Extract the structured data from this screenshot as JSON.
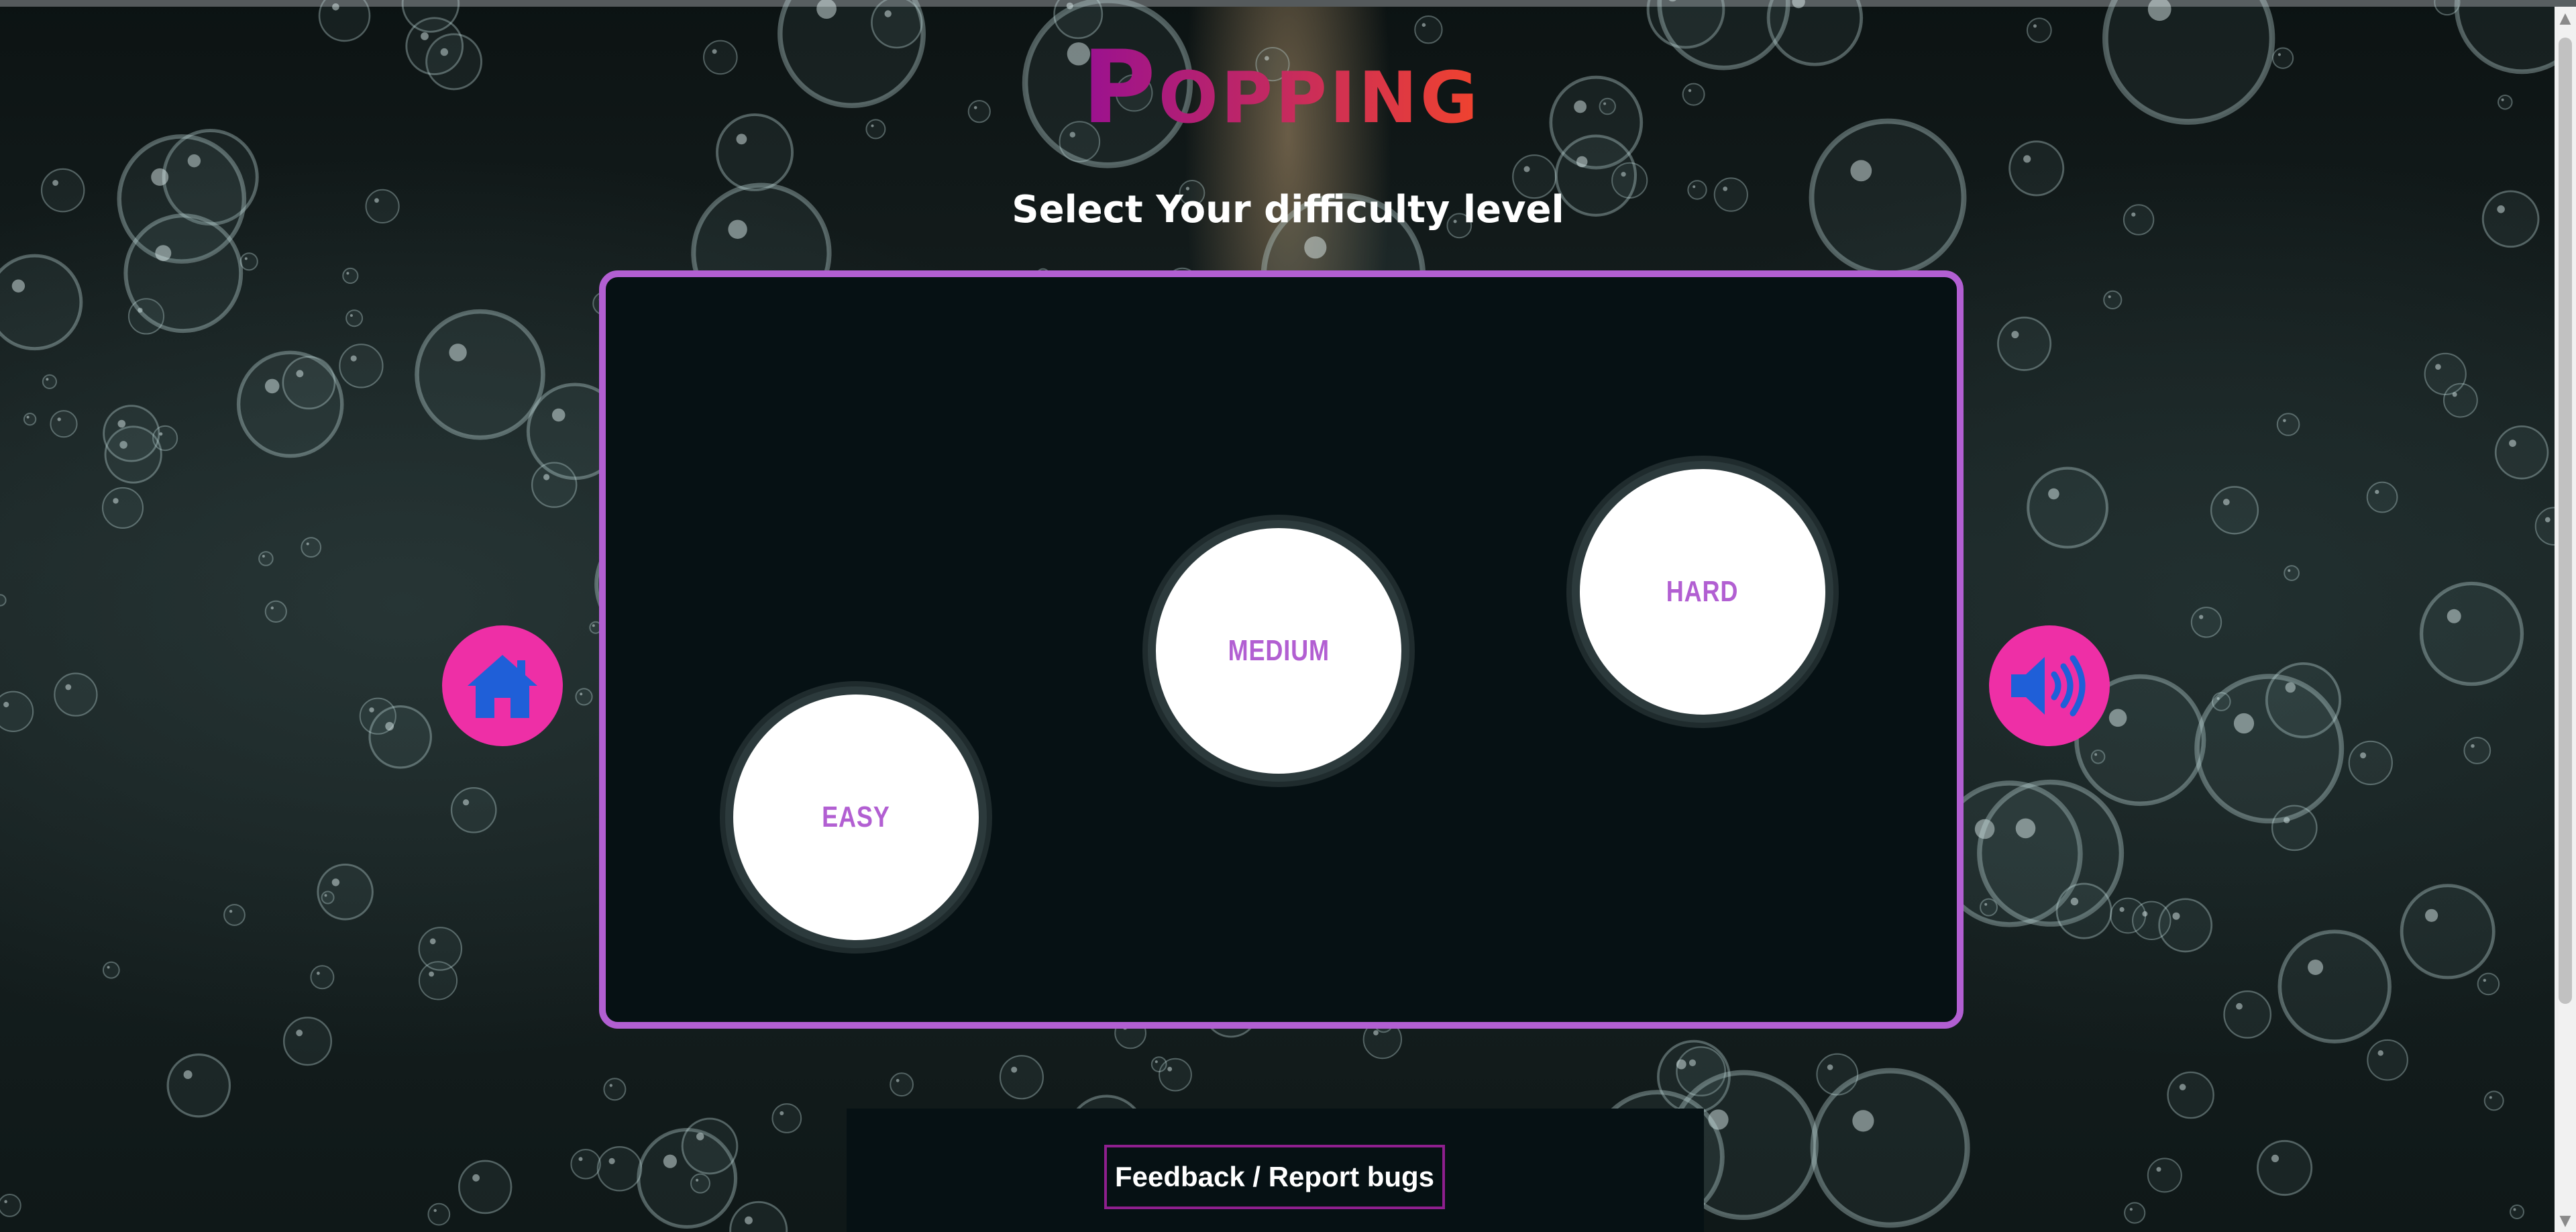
{
  "game": {
    "title": "Popping",
    "subtitle": "Select Your difficulty level"
  },
  "levels": [
    {
      "label": "EASY"
    },
    {
      "label": "MEDIUM"
    },
    {
      "label": "HARD"
    }
  ],
  "controls": {
    "home_icon": "home-icon",
    "sound_icon": "speaker-volume-icon"
  },
  "footer": {
    "feedback_label": "Feedback / Report bugs"
  },
  "colors": {
    "accent": "#b25fd2",
    "button_pink": "#ee2fa6",
    "icon_blue": "#1f5fd8",
    "board_bg": "#061114",
    "logo_gradient_start": "#9a1190",
    "logo_gradient_end": "#f0432e"
  }
}
